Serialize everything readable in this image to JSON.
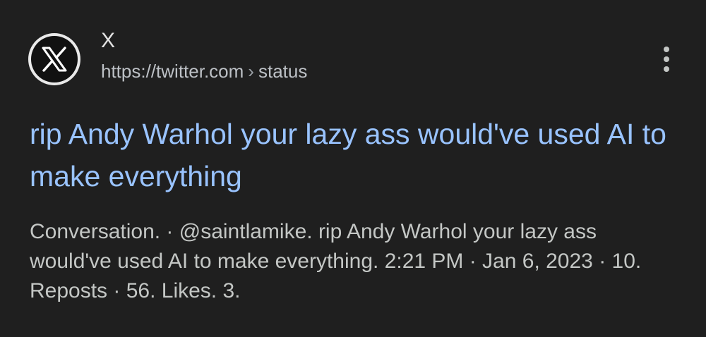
{
  "result": {
    "site_name": "X",
    "url_domain": "https://twitter.com",
    "url_separator": "›",
    "url_path": "status",
    "title": "rip Andy Warhol your lazy ass would've used AI to make everything",
    "snippet": "Conversation. · @saintlamike. rip Andy Warhol your lazy ass would've used AI to make everything. 2:21 PM · Jan 6, 2023 · 10. Reposts · 56. Likes. 3.",
    "favicon_icon": "x-logo-icon",
    "menu_icon": "more-vert-icon"
  },
  "colors": {
    "background": "#1f1f1f",
    "title_link": "#99c3ff",
    "text": "#c4c7c5"
  }
}
